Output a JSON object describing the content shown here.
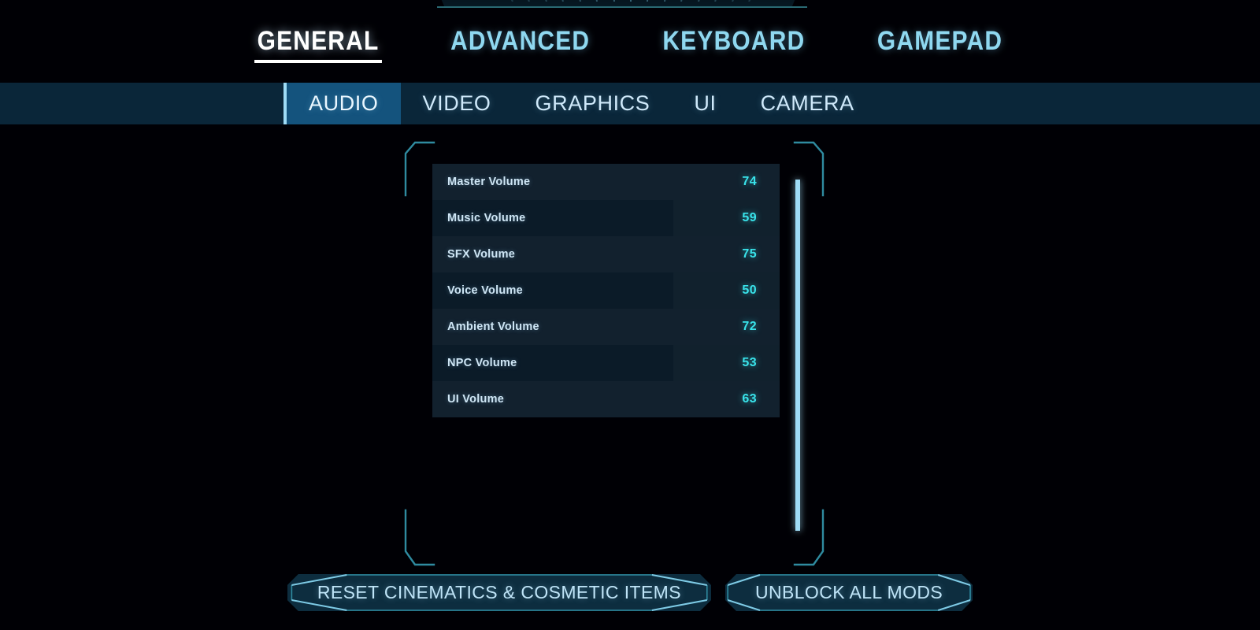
{
  "window": {
    "background_color": "#000005",
    "accent_color": "#39e3ea",
    "panel_border_color": "#2f8ba0",
    "scrollbar_color": "#9fdcf6"
  },
  "primary_nav": {
    "items": [
      {
        "label": "GENERAL",
        "active": true
      },
      {
        "label": "ADVANCED",
        "active": false
      },
      {
        "label": "KEYBOARD",
        "active": false
      },
      {
        "label": "GAMEPAD",
        "active": false
      }
    ]
  },
  "sub_nav": {
    "items": [
      {
        "label": "AUDIO",
        "active": true
      },
      {
        "label": "VIDEO",
        "active": false
      },
      {
        "label": "GRAPHICS",
        "active": false
      },
      {
        "label": "UI",
        "active": false
      },
      {
        "label": "CAMERA",
        "active": false
      }
    ]
  },
  "settings": {
    "rows": [
      {
        "label": "Master Volume",
        "value": "74",
        "fill": false
      },
      {
        "label": "Music Volume",
        "value": "59",
        "fill": true
      },
      {
        "label": "SFX Volume",
        "value": "75",
        "fill": false
      },
      {
        "label": "Voice Volume",
        "value": "50",
        "fill": true
      },
      {
        "label": "Ambient Volume",
        "value": "72",
        "fill": false
      },
      {
        "label": "NPC Volume",
        "value": "53",
        "fill": true
      },
      {
        "label": "UI Volume",
        "value": "63",
        "fill": false
      }
    ]
  },
  "scrollbar": {
    "position": "top",
    "thumb_color": "#9fdcf6"
  },
  "footer": {
    "buttons": [
      {
        "label": "RESET CINEMATICS & COSMETIC ITEMS"
      },
      {
        "label": "UNBLOCK ALL MODS"
      }
    ]
  }
}
